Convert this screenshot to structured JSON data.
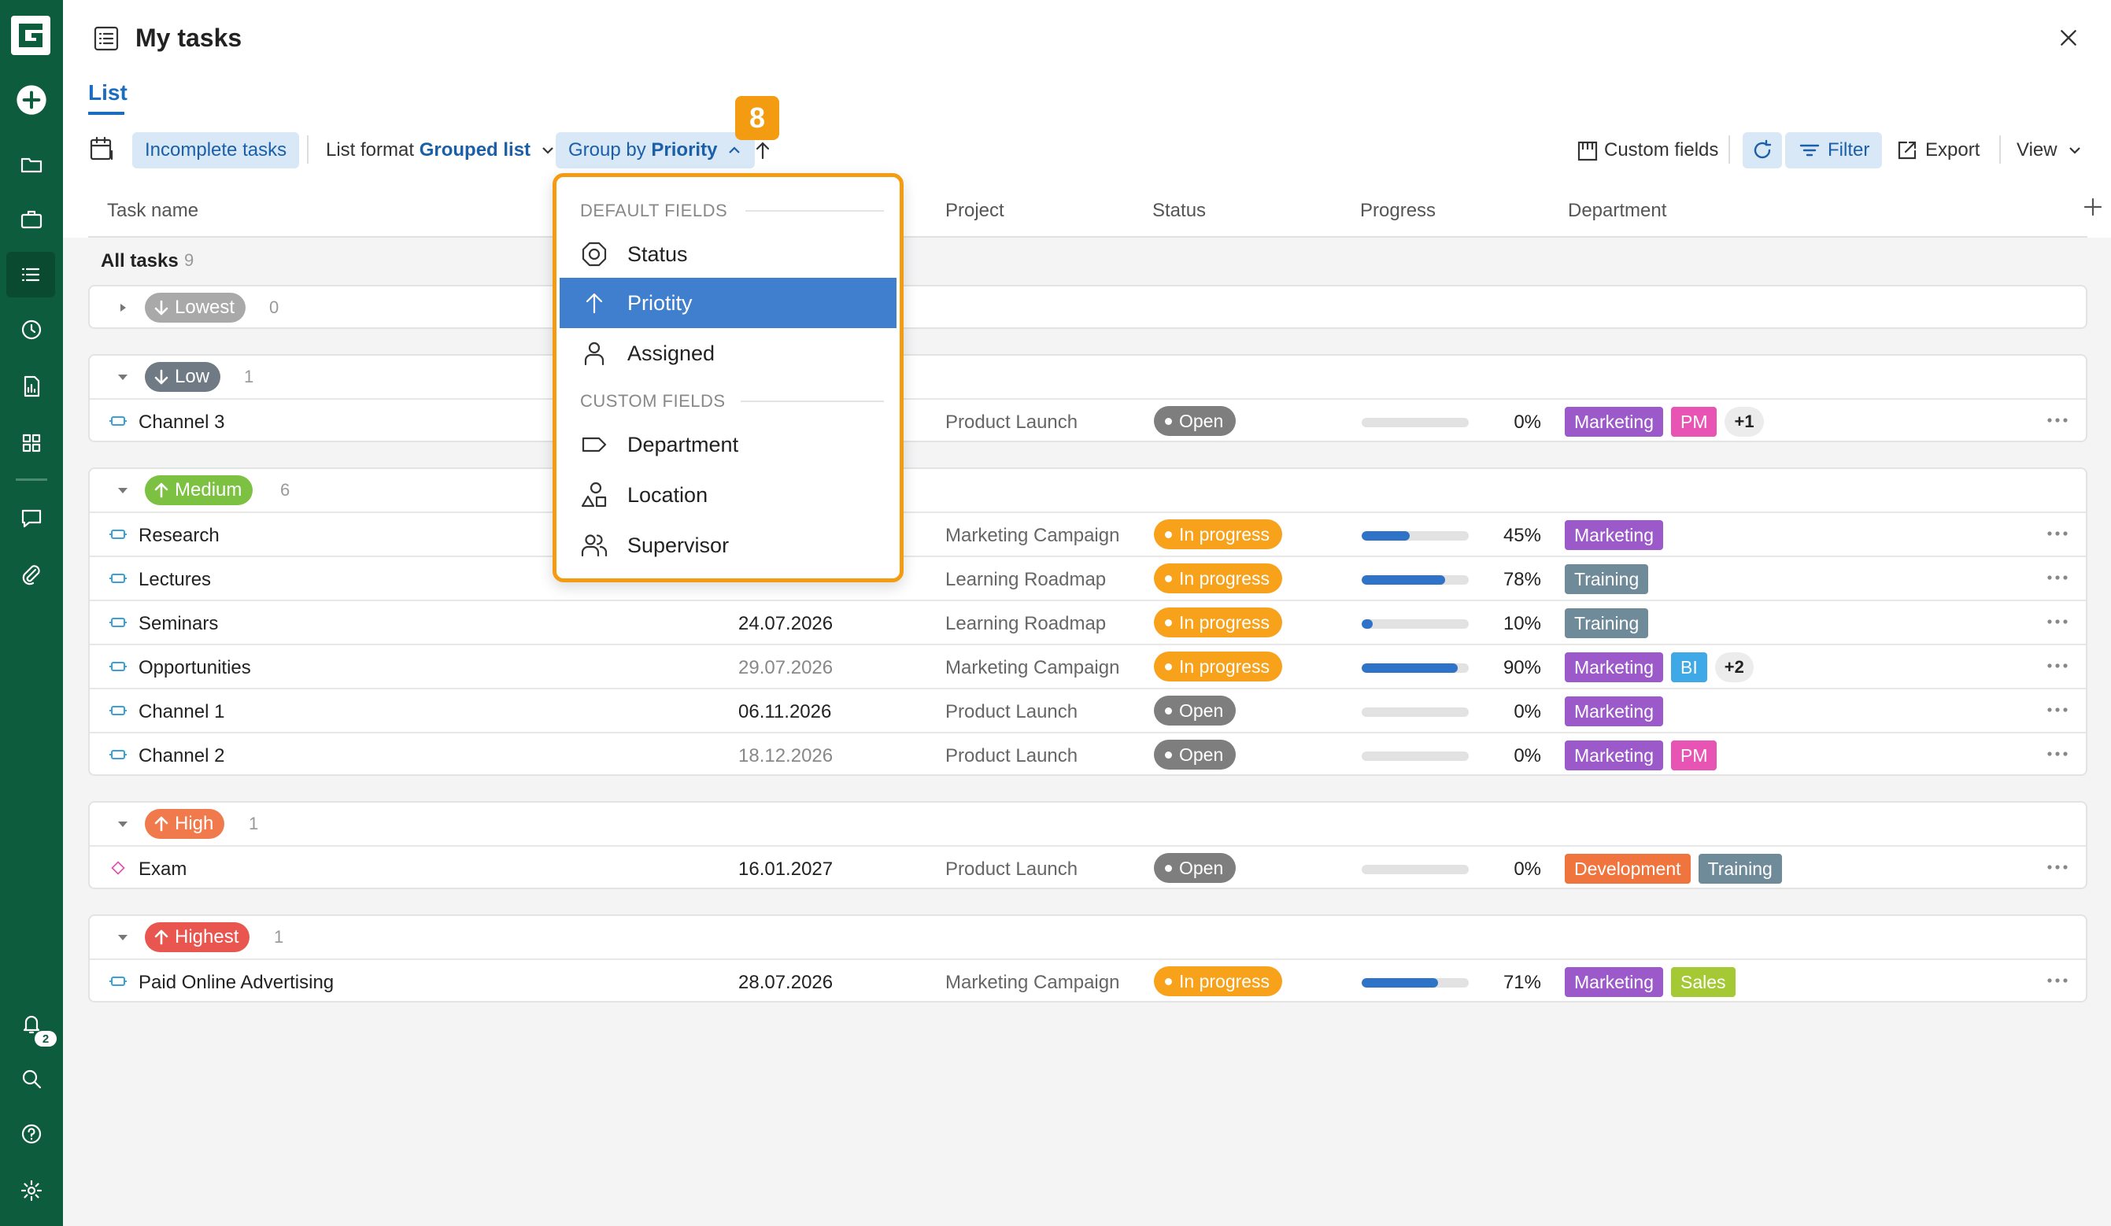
{
  "header": {
    "title": "My tasks",
    "tab": "List"
  },
  "toolbar": {
    "incomplete": "Incomplete tasks",
    "list_format_label": "List format",
    "list_format_value": "Grouped list",
    "group_by_label": "Group by",
    "group_by_value": "Priority",
    "step_badge": "8",
    "custom_fields": "Custom fields",
    "filter": "Filter",
    "export": "Export",
    "view": "View"
  },
  "columns": {
    "task_name": "Task name",
    "project": "Project",
    "status": "Status",
    "progress": "Progress",
    "department": "Department"
  },
  "all_tasks": {
    "label": "All tasks",
    "count": "9"
  },
  "groups": [
    {
      "label": "Lowest",
      "count": "0",
      "color": "#a9a9a9",
      "rows": []
    },
    {
      "label": "Low",
      "count": "1",
      "color": "#6f7a85",
      "rows": [
        {
          "name": "Channel 3",
          "date": "",
          "project": "Product Launch",
          "status": "Open",
          "progress": 0,
          "pct": "0%",
          "depts": [
            "Marketing",
            "PM"
          ],
          "more": "+1"
        }
      ]
    },
    {
      "label": "Medium",
      "count": "6",
      "color": "#7cc142",
      "rows": [
        {
          "name": "Research",
          "date": "",
          "project": "Marketing Campaign",
          "status": "In progress",
          "progress": 45,
          "pct": "45%",
          "depts": [
            "Marketing"
          ],
          "more": ""
        },
        {
          "name": "Lectures",
          "date": "",
          "project": "Learning Roadmap",
          "status": "In progress",
          "progress": 78,
          "pct": "78%",
          "depts": [
            "Training"
          ],
          "more": ""
        },
        {
          "name": "Seminars",
          "date": "24.07.2026",
          "project": "Learning Roadmap",
          "status": "In progress",
          "progress": 10,
          "pct": "10%",
          "depts": [
            "Training"
          ],
          "more": ""
        },
        {
          "name": "Opportunities",
          "date": "29.07.2026",
          "project": "Marketing Campaign",
          "status": "In progress",
          "progress": 90,
          "pct": "90%",
          "depts": [
            "Marketing",
            "BI"
          ],
          "more": "+2"
        },
        {
          "name": "Channel 1",
          "date": "06.11.2026",
          "project": "Product Launch",
          "status": "Open",
          "progress": 0,
          "pct": "0%",
          "depts": [
            "Marketing"
          ],
          "more": ""
        },
        {
          "name": "Channel 2",
          "date": "18.12.2026",
          "project": "Product Launch",
          "status": "Open",
          "progress": 0,
          "pct": "0%",
          "depts": [
            "Marketing",
            "PM"
          ],
          "more": ""
        }
      ]
    },
    {
      "label": "High",
      "count": "1",
      "color": "#f07a4b",
      "rows": [
        {
          "name": "Exam",
          "date": "16.01.2027",
          "project": "Product Launch",
          "status": "Open",
          "progress": 0,
          "pct": "0%",
          "depts": [
            "Development",
            "Training"
          ],
          "more": ""
        }
      ]
    },
    {
      "label": "Highest",
      "count": "1",
      "color": "#e9554f",
      "rows": [
        {
          "name": "Paid Online Advertising",
          "date": "28.07.2026",
          "project": "Marketing Campaign",
          "status": "In progress",
          "progress": 71,
          "pct": "71%",
          "depts": [
            "Marketing",
            "Sales"
          ],
          "more": ""
        }
      ]
    }
  ],
  "dept_colors": {
    "Marketing": "#9b59c9",
    "PM": "#e754b3",
    "Training": "#6f8a99",
    "BI": "#3fa8e6",
    "Development": "#f0743e",
    "Sales": "#a4c935"
  },
  "status_colors": {
    "Open": "#7e7e7e",
    "In progress": "#f8a11b"
  },
  "dropdown": {
    "default_fields": "DEFAULT FIELDS",
    "custom_fields": "CUSTOM FIELDS",
    "items": [
      "Status",
      "Priotity",
      "Assigned",
      "Department",
      "Location",
      "Supervisor"
    ]
  },
  "sidebar": {
    "notif_count": "2"
  }
}
